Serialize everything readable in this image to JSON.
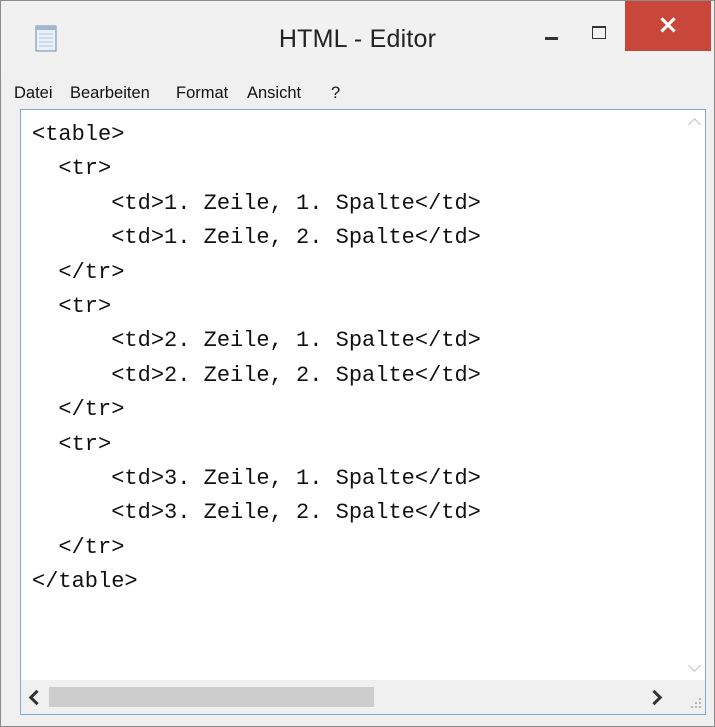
{
  "window": {
    "title": "HTML - Editor",
    "icon": "notepad-icon",
    "controls": {
      "minimize": "minimize-icon",
      "maximize": "maximize-icon",
      "close": "×"
    },
    "close_color": "#c9473a"
  },
  "menu": {
    "items": [
      {
        "label": "Datei"
      },
      {
        "label": "Bearbeiten"
      },
      {
        "label": "Format"
      },
      {
        "label": "Ansicht"
      },
      {
        "label": "?"
      }
    ]
  },
  "editor": {
    "lines": [
      "<table>",
      "  <tr>",
      "      <td>1. Zeile, 1. Spalte</td>",
      "      <td>1. Zeile, 2. Spalte</td>",
      "  </tr>",
      "  <tr>",
      "      <td>2. Zeile, 1. Spalte</td>",
      "      <td>2. Zeile, 2. Spalte</td>",
      "  </tr>",
      "  <tr>",
      "      <td>3. Zeile, 1. Spalte</td>",
      "      <td>3. Zeile, 2. Spalte</td>",
      "  </tr>",
      "</table>"
    ]
  }
}
